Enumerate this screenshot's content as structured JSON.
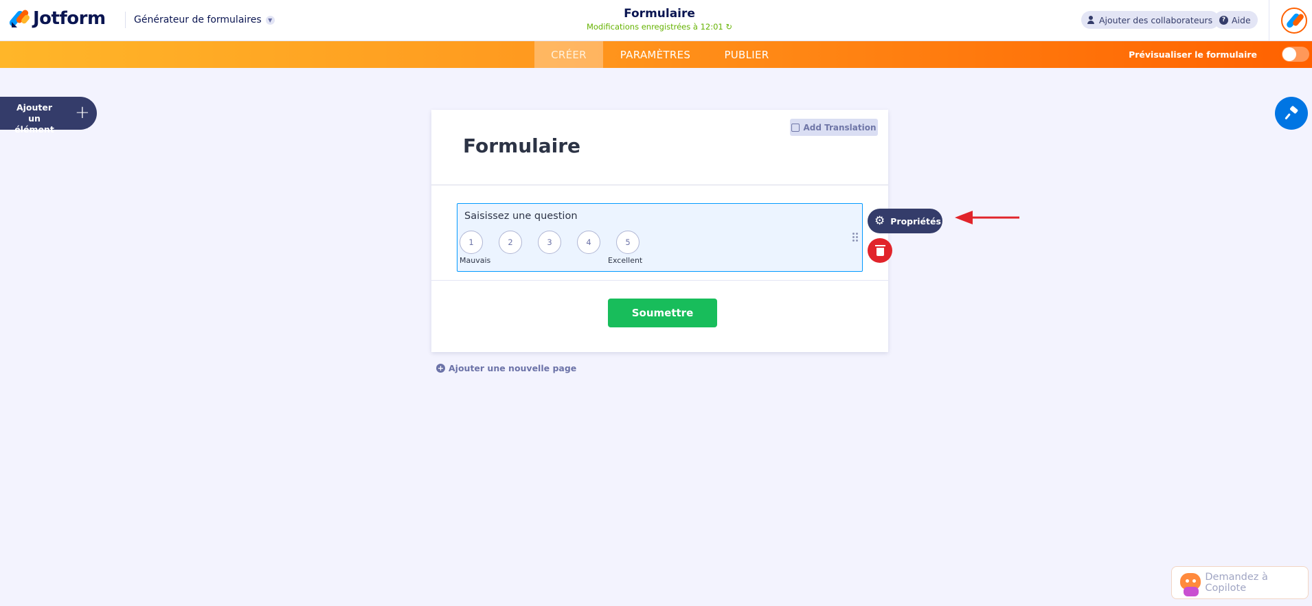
{
  "header": {
    "logo_text": "Jotform",
    "builder_label": "Générateur de formulaires",
    "form_title": "Formulaire",
    "save_status": "Modifications enregistrées à 12:01 ↻",
    "collaborators_label": "Ajouter des collaborateurs",
    "help_label": "Aide"
  },
  "nav": {
    "tabs": [
      {
        "label": "CRÉER",
        "active": true
      },
      {
        "label": "PARAMÈTRES",
        "active": false
      },
      {
        "label": "PUBLIER",
        "active": false
      }
    ],
    "preview_label": "Prévisualiser le formulaire",
    "preview_on": false
  },
  "sidebar": {
    "add_element_label": "Ajouter un élément",
    "add_icon": "+"
  },
  "form": {
    "title": "Formulaire",
    "add_translation_label": "Add Translation",
    "question": {
      "label": "Saisissez une question",
      "scale": [
        "1",
        "2",
        "3",
        "4",
        "5"
      ],
      "low_label": "Mauvais",
      "high_label": "Excellent"
    },
    "submit_label": "Soumettre",
    "add_page_label": "Ajouter une nouvelle page"
  },
  "field_tools": {
    "properties_label": "Propriétés"
  },
  "copilot": {
    "label": "Demandez à Copilote"
  },
  "colors": {
    "brand_orange": "#ff6100",
    "accent_blue": "#0099ff",
    "submit_green": "#18bd5b",
    "delete_red": "#e1242b",
    "annotation_arrow": "#e1242b"
  }
}
